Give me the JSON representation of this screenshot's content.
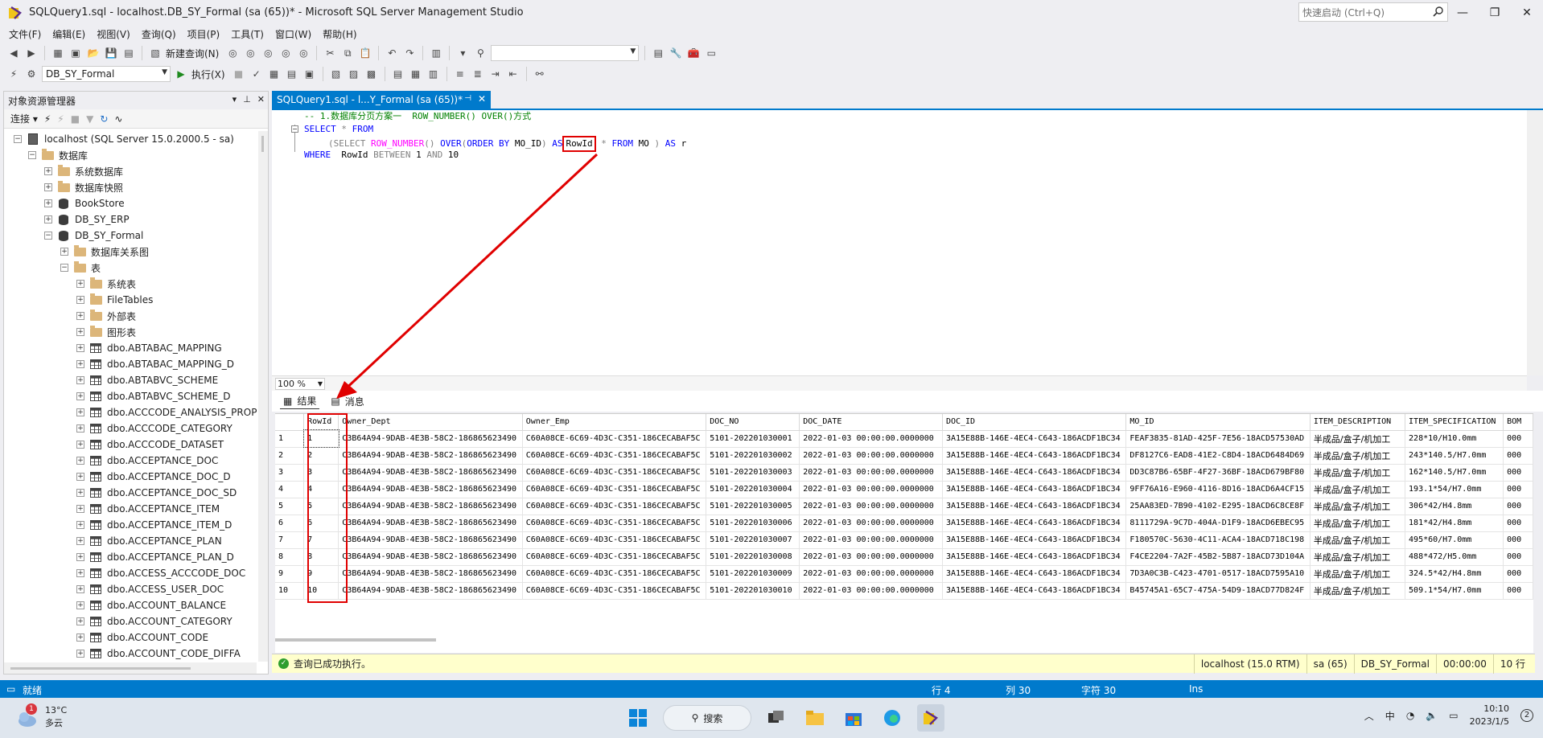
{
  "window": {
    "title": "SQLQuery1.sql - localhost.DB_SY_Formal (sa (65))* - Microsoft SQL Server Management Studio",
    "quick_launch": "快速启动 (Ctrl+Q)"
  },
  "menu": [
    "文件(F)",
    "编辑(E)",
    "视图(V)",
    "查询(Q)",
    "项目(P)",
    "工具(T)",
    "窗口(W)",
    "帮助(H)"
  ],
  "toolbar": {
    "new_query": "新建查询(N)",
    "database": "DB_SY_Formal",
    "execute": "执行(X)"
  },
  "object_explorer": {
    "title": "对象资源管理器",
    "connect": "连接",
    "tree": [
      {
        "label": "localhost (SQL Server 15.0.2000.5 - sa)",
        "level": 0,
        "exp": "−",
        "icon": "server-icon"
      },
      {
        "label": "数据库",
        "level": 1,
        "exp": "−",
        "icon": "folder-icon"
      },
      {
        "label": "系统数据库",
        "level": 2,
        "exp": "+",
        "icon": "folder-icon"
      },
      {
        "label": "数据库快照",
        "level": 2,
        "exp": "+",
        "icon": "folder-icon"
      },
      {
        "label": "BookStore",
        "level": 2,
        "exp": "+",
        "icon": "database-icon"
      },
      {
        "label": "DB_SY_ERP",
        "level": 2,
        "exp": "+",
        "icon": "database-icon"
      },
      {
        "label": "DB_SY_Formal",
        "level": 2,
        "exp": "−",
        "icon": "database-icon"
      },
      {
        "label": "数据库关系图",
        "level": 3,
        "exp": "+",
        "icon": "folder-icon"
      },
      {
        "label": "表",
        "level": 3,
        "exp": "−",
        "icon": "folder-icon"
      },
      {
        "label": "系统表",
        "level": 4,
        "exp": "+",
        "icon": "folder-icon"
      },
      {
        "label": "FileTables",
        "level": 4,
        "exp": "+",
        "icon": "folder-icon"
      },
      {
        "label": "外部表",
        "level": 4,
        "exp": "+",
        "icon": "folder-icon"
      },
      {
        "label": "图形表",
        "level": 4,
        "exp": "+",
        "icon": "folder-icon"
      },
      {
        "label": "dbo.ABTABAC_MAPPING",
        "level": 4,
        "exp": "+",
        "icon": "table-icon"
      },
      {
        "label": "dbo.ABTABAC_MAPPING_D",
        "level": 4,
        "exp": "+",
        "icon": "table-icon"
      },
      {
        "label": "dbo.ABTABVC_SCHEME",
        "level": 4,
        "exp": "+",
        "icon": "table-icon"
      },
      {
        "label": "dbo.ABTABVC_SCHEME_D",
        "level": 4,
        "exp": "+",
        "icon": "table-icon"
      },
      {
        "label": "dbo.ACCCODE_ANALYSIS_PROPI",
        "level": 4,
        "exp": "+",
        "icon": "table-icon"
      },
      {
        "label": "dbo.ACCCODE_CATEGORY",
        "level": 4,
        "exp": "+",
        "icon": "table-icon"
      },
      {
        "label": "dbo.ACCCODE_DATASET",
        "level": 4,
        "exp": "+",
        "icon": "table-icon"
      },
      {
        "label": "dbo.ACCEPTANCE_DOC",
        "level": 4,
        "exp": "+",
        "icon": "table-icon"
      },
      {
        "label": "dbo.ACCEPTANCE_DOC_D",
        "level": 4,
        "exp": "+",
        "icon": "table-icon"
      },
      {
        "label": "dbo.ACCEPTANCE_DOC_SD",
        "level": 4,
        "exp": "+",
        "icon": "table-icon"
      },
      {
        "label": "dbo.ACCEPTANCE_ITEM",
        "level": 4,
        "exp": "+",
        "icon": "table-icon"
      },
      {
        "label": "dbo.ACCEPTANCE_ITEM_D",
        "level": 4,
        "exp": "+",
        "icon": "table-icon"
      },
      {
        "label": "dbo.ACCEPTANCE_PLAN",
        "level": 4,
        "exp": "+",
        "icon": "table-icon"
      },
      {
        "label": "dbo.ACCEPTANCE_PLAN_D",
        "level": 4,
        "exp": "+",
        "icon": "table-icon"
      },
      {
        "label": "dbo.ACCESS_ACCCODE_DOC",
        "level": 4,
        "exp": "+",
        "icon": "table-icon"
      },
      {
        "label": "dbo.ACCESS_USER_DOC",
        "level": 4,
        "exp": "+",
        "icon": "table-icon"
      },
      {
        "label": "dbo.ACCOUNT_BALANCE",
        "level": 4,
        "exp": "+",
        "icon": "table-icon"
      },
      {
        "label": "dbo.ACCOUNT_CATEGORY",
        "level": 4,
        "exp": "+",
        "icon": "table-icon"
      },
      {
        "label": "dbo.ACCOUNT_CODE",
        "level": 4,
        "exp": "+",
        "icon": "table-icon"
      },
      {
        "label": "dbo.ACCOUNT_CODE_DIFFA",
        "level": 4,
        "exp": "+",
        "icon": "table-icon"
      }
    ]
  },
  "editor": {
    "tab_title": "SQLQuery1.sql - l...Y_Formal (sa (65))*",
    "code": {
      "l1": "-- 1.数据库分页方案一  ROW_NUMBER() OVER()方式",
      "l2a": "SELECT",
      "l2b": " * ",
      "l2c": "FROM",
      "l3a": "(SELECT ",
      "l3b": "ROW_NUMBER",
      "l3c": "() ",
      "l3d": "OVER",
      "l3e": "(",
      "l3f": "ORDER BY",
      "l3g": " MO_ID",
      "l3h": ") ",
      "l3i": "AS",
      "l3j": "RowId",
      "l3k": " * ",
      "l3l": "FROM",
      "l3m": " MO ",
      "l3n": ") ",
      "l3o": "AS",
      "l3p": " r",
      "l4a": "WHERE",
      "l4b": "  RowId ",
      "l4c": "BETWEEN",
      "l4d": " 1 ",
      "l4e": "AND",
      "l4f": " 10"
    },
    "zoom": "100 %"
  },
  "results": {
    "tab_results": "结果",
    "tab_messages": "消息",
    "columns": [
      "RowId",
      "Owner_Dept",
      "Owner_Emp",
      "DOC_NO",
      "DOC_DATE",
      "DOC_ID",
      "MO_ID",
      "ITEM_DESCRIPTION",
      "ITEM_SPECIFICATION",
      "BOM"
    ],
    "rows": [
      [
        "1",
        "1",
        "C3B64A94-9DAB-4E3B-58C2-186865623490",
        "C60A08CE-6C69-4D3C-C351-186CECABAF5C",
        "5101-202201030001",
        "2022-01-03 00:00:00.0000000",
        "3A15E88B-146E-4EC4-C643-186ACDF1BC34",
        "FEAF3835-81AD-425F-7E56-18ACD57530AD",
        "半成品/盒子/机加工",
        "228*10/H10.0mm",
        "000"
      ],
      [
        "2",
        "2",
        "C3B64A94-9DAB-4E3B-58C2-186865623490",
        "C60A08CE-6C69-4D3C-C351-186CECABAF5C",
        "5101-202201030002",
        "2022-01-03 00:00:00.0000000",
        "3A15E88B-146E-4EC4-C643-186ACDF1BC34",
        "DF8127C6-EAD8-41E2-C8D4-18ACD6484D69",
        "半成品/盒子/机加工",
        "243*140.5/H7.0mm",
        "000"
      ],
      [
        "3",
        "3",
        "C3B64A94-9DAB-4E3B-58C2-186865623490",
        "C60A08CE-6C69-4D3C-C351-186CECABAF5C",
        "5101-202201030003",
        "2022-01-03 00:00:00.0000000",
        "3A15E88B-146E-4EC4-C643-186ACDF1BC34",
        "DD3C87B6-65BF-4F27-36BF-18ACD679BF80",
        "半成品/盒子/机加工",
        "162*140.5/H7.0mm",
        "000"
      ],
      [
        "4",
        "4",
        "C3B64A94-9DAB-4E3B-58C2-186865623490",
        "C60A08CE-6C69-4D3C-C351-186CECABAF5C",
        "5101-202201030004",
        "2022-01-03 00:00:00.0000000",
        "3A15E88B-146E-4EC4-C643-186ACDF1BC34",
        "9FF76A16-E960-4116-8D16-18ACD6A4CF15",
        "半成品/盒子/机加工",
        "193.1*54/H7.0mm",
        "000"
      ],
      [
        "5",
        "5",
        "C3B64A94-9DAB-4E3B-58C2-186865623490",
        "C60A08CE-6C69-4D3C-C351-186CECABAF5C",
        "5101-202201030005",
        "2022-01-03 00:00:00.0000000",
        "3A15E88B-146E-4EC4-C643-186ACDF1BC34",
        "25AA83ED-7B90-4102-E295-18ACD6C8CE8F",
        "半成品/盒子/机加工",
        "306*42/H4.8mm",
        "000"
      ],
      [
        "6",
        "6",
        "C3B64A94-9DAB-4E3B-58C2-186865623490",
        "C60A08CE-6C69-4D3C-C351-186CECABAF5C",
        "5101-202201030006",
        "2022-01-03 00:00:00.0000000",
        "3A15E88B-146E-4EC4-C643-186ACDF1BC34",
        "8111729A-9C7D-404A-D1F9-18ACD6EBEC95",
        "半成品/盒子/机加工",
        "181*42/H4.8mm",
        "000"
      ],
      [
        "7",
        "7",
        "C3B64A94-9DAB-4E3B-58C2-186865623490",
        "C60A08CE-6C69-4D3C-C351-186CECABAF5C",
        "5101-202201030007",
        "2022-01-03 00:00:00.0000000",
        "3A15E88B-146E-4EC4-C643-186ACDF1BC34",
        "F180570C-5630-4C11-ACA4-18ACD718C198",
        "半成品/盒子/机加工",
        "495*60/H7.0mm",
        "000"
      ],
      [
        "8",
        "8",
        "C3B64A94-9DAB-4E3B-58C2-186865623490",
        "C60A08CE-6C69-4D3C-C351-186CECABAF5C",
        "5101-202201030008",
        "2022-01-03 00:00:00.0000000",
        "3A15E88B-146E-4EC4-C643-186ACDF1BC34",
        "F4CE2204-7A2F-45B2-5B87-18ACD73D104A",
        "半成品/盒子/机加工",
        "488*472/H5.0mm",
        "000"
      ],
      [
        "9",
        "9",
        "C3B64A94-9DAB-4E3B-58C2-186865623490",
        "C60A08CE-6C69-4D3C-C351-186CECABAF5C",
        "5101-202201030009",
        "2022-01-03 00:00:00.0000000",
        "3A15E88B-146E-4EC4-C643-186ACDF1BC34",
        "7D3A0C3B-C423-4701-0517-18ACD7595A10",
        "半成品/盒子/机加工",
        "324.5*42/H4.8mm",
        "000"
      ],
      [
        "10",
        "10",
        "C3B64A94-9DAB-4E3B-58C2-186865623490",
        "C60A08CE-6C69-4D3C-C351-186CECABAF5C",
        "5101-202201030010",
        "2022-01-03 00:00:00.0000000",
        "3A15E88B-146E-4EC4-C643-186ACDF1BC34",
        "B45745A1-65C7-475A-54D9-18ACD77D824F",
        "半成品/盒子/机加工",
        "509.1*54/H7.0mm",
        "000"
      ]
    ]
  },
  "query_status": {
    "message": "查询已成功执行。",
    "server": "localhost (15.0 RTM)",
    "user": "sa (65)",
    "database": "DB_SY_Formal",
    "time": "00:00:00",
    "rows": "10 行"
  },
  "app_status": {
    "ready": "就绪",
    "row": "行 4",
    "col": "列 30",
    "char": "字符 30",
    "mode": "Ins"
  },
  "taskbar": {
    "temp": "13°C",
    "weather": "多云",
    "weather_badge": "1",
    "search": "搜索",
    "ime": "中",
    "time": "10:10",
    "date": "2023/1/5",
    "notif": "2"
  },
  "colors": {
    "accent": "#007acc",
    "annotation": "#e00000",
    "keyword": "#0000ff",
    "function": "#ff00ff",
    "comment": "#008000"
  }
}
